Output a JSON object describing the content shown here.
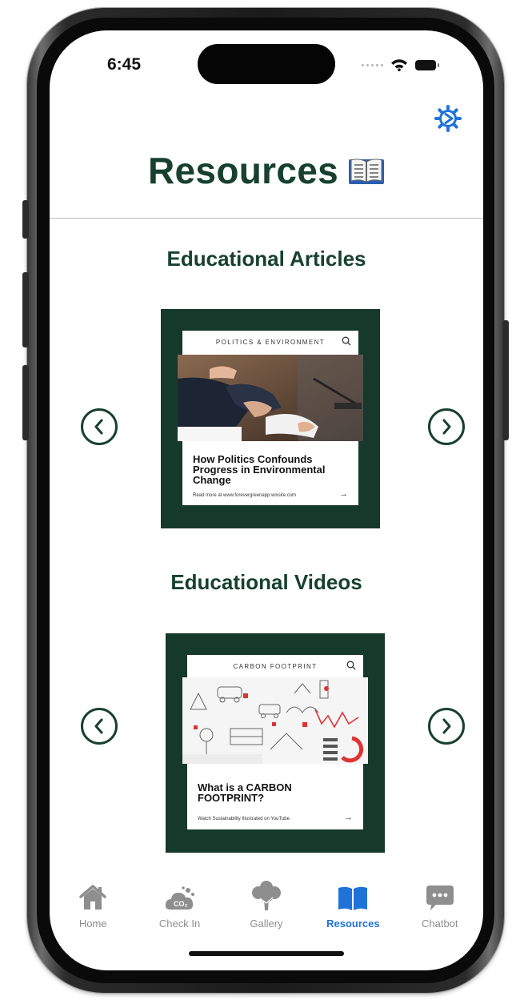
{
  "status_bar": {
    "time": "6:45"
  },
  "header": {
    "title": "Resources",
    "title_emoji": "📖"
  },
  "colors": {
    "brand_green": "#17402f",
    "card_green": "#15392a",
    "tab_active": "#1f73d8",
    "tab_inactive": "#8e8e8e"
  },
  "sections": {
    "articles": {
      "title": "Educational Articles",
      "card": {
        "category": "POLITICS & ENVIRONMENT",
        "headline": "How Politics Confounds Progress in Environmental Change",
        "footer": "Read more at www.forevergreenapp.wixsite.com"
      }
    },
    "videos": {
      "title": "Educational Videos",
      "card": {
        "category": "CARBON FOOTPRINT",
        "headline": "What is a CARBON FOOTPRINT?",
        "footer": "Watch Sustainability Illustrated on YouTube"
      }
    }
  },
  "tab_bar": {
    "selected": "Resources",
    "items": [
      {
        "label": "Home",
        "icon": "house-icon"
      },
      {
        "label": "Check In",
        "icon": "co2-cloud-icon"
      },
      {
        "label": "Gallery",
        "icon": "tree-icon"
      },
      {
        "label": "Resources",
        "icon": "book-icon"
      },
      {
        "label": "Chatbot",
        "icon": "chat-bubble-icon"
      }
    ]
  }
}
